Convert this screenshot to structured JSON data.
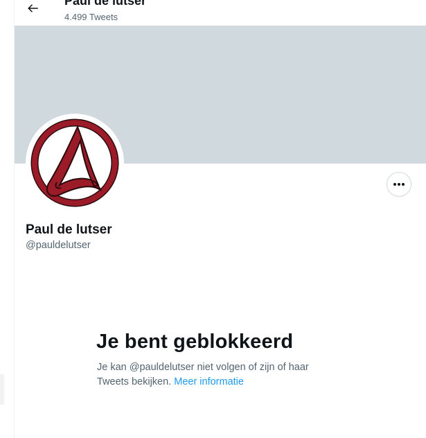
{
  "header": {
    "back_icon": "arrow-left-icon",
    "title": "Paul de lutser",
    "tweet_count": "4.499 Tweets"
  },
  "banner": {
    "color": "#cfd9de"
  },
  "profile": {
    "avatar_icon": "atheism-a-logo",
    "avatar_color": "#8b1a24",
    "more_icon": "ellipsis-icon",
    "name": "Paul de lutser",
    "handle": "@pauldelutser"
  },
  "blocked": {
    "title": "Je bent geblokkeerd",
    "message": "Je kan @pauldelutser niet volgen of zijn of haar Tweets bekijken.",
    "link_label": "Meer informatie",
    "link_color": "#1d9bf0"
  }
}
